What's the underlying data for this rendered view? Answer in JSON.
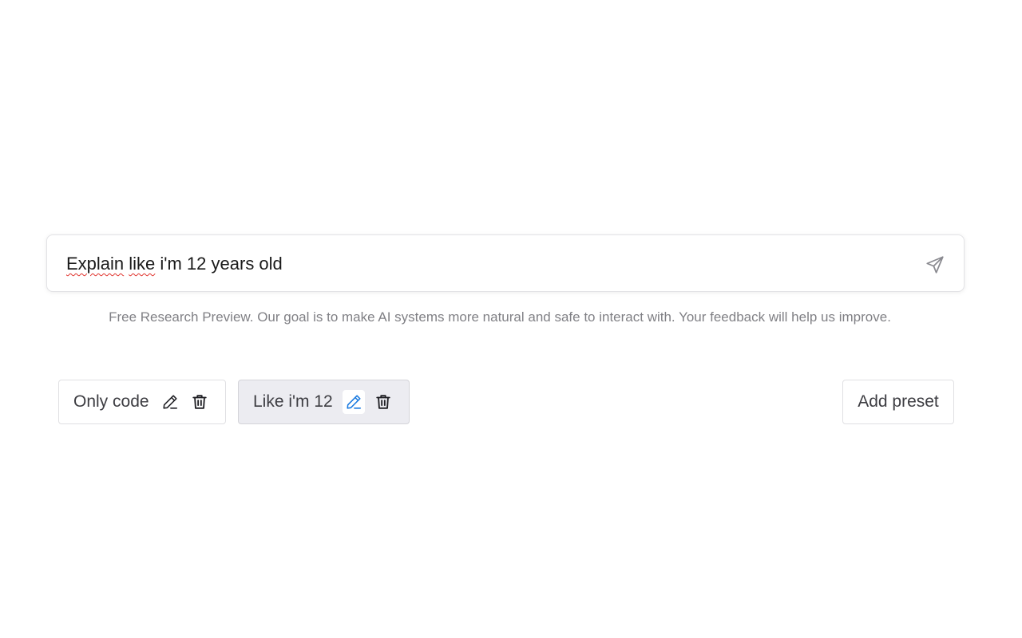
{
  "prompt": {
    "value": "Explain like i'm 12 years old",
    "word_explain": "Explain",
    "word_like": "like",
    "word_rest": " i'm 12 years old",
    "send_icon": "send-icon"
  },
  "disclaimer": "Free Research Preview. Our goal is to make AI systems more natural and safe to interact with. Your feedback will help us improve.",
  "presets": [
    {
      "label": "Only code",
      "active": false,
      "edit_icon": "pencil-icon",
      "delete_icon": "trash-icon"
    },
    {
      "label": "Like i'm 12",
      "active": true,
      "edit_icon": "pencil-icon",
      "delete_icon": "trash-icon"
    }
  ],
  "add_preset_label": "Add preset",
  "colors": {
    "active_preset_bg": "#ececf1",
    "active_edit_icon": "#1a7ae0",
    "text": "#3d3d42",
    "muted": "#808085"
  }
}
